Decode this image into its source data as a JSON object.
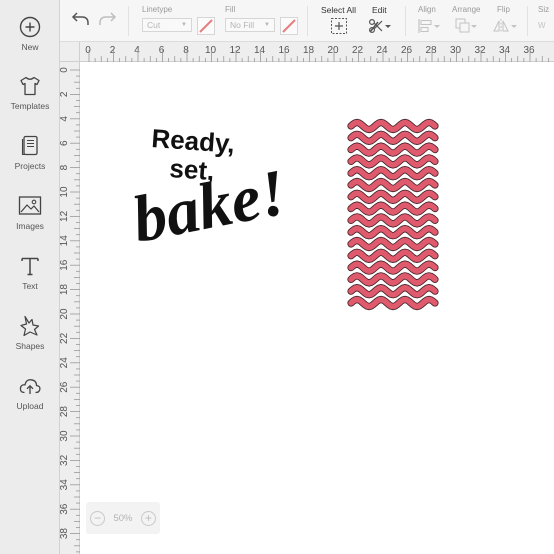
{
  "sidebar": {
    "items": [
      {
        "label": "New",
        "icon": "plus-circle-icon"
      },
      {
        "label": "Templates",
        "icon": "shirt-icon"
      },
      {
        "label": "Projects",
        "icon": "projects-icon"
      },
      {
        "label": "Images",
        "icon": "image-icon"
      },
      {
        "label": "Text",
        "icon": "text-icon"
      },
      {
        "label": "Shapes",
        "icon": "shapes-icon"
      },
      {
        "label": "Upload",
        "icon": "upload-icon"
      }
    ]
  },
  "toolbar": {
    "linetype": {
      "label": "Linetype",
      "value": "Cut"
    },
    "fill": {
      "label": "Fill",
      "value": "No Fill"
    },
    "select_all": {
      "label": "Select All"
    },
    "edit": {
      "label": "Edit"
    },
    "align": {
      "label": "Align"
    },
    "arrange": {
      "label": "Arrange"
    },
    "flip": {
      "label": "Flip"
    },
    "size": {
      "label": "Siz"
    }
  },
  "ruler": {
    "top": [
      "0",
      "2",
      "4",
      "6",
      "8",
      "10",
      "12",
      "14",
      "16",
      "18",
      "20",
      "22",
      "24",
      "26",
      "28",
      "30",
      "32",
      "34",
      "36"
    ],
    "left": [
      "0",
      "2",
      "4",
      "6",
      "8",
      "10",
      "12",
      "14",
      "16",
      "18",
      "20",
      "22",
      "24",
      "26",
      "28",
      "30",
      "32",
      "34",
      "36",
      "38"
    ]
  },
  "canvas": {
    "text_design": {
      "line1": "Ready,",
      "line2": "set,",
      "line3": "bake!"
    },
    "wavy_pattern": {
      "color": "#e05a6d",
      "waves": 16
    }
  },
  "zoom": {
    "level": "50%",
    "minus": "−",
    "plus": "+"
  }
}
